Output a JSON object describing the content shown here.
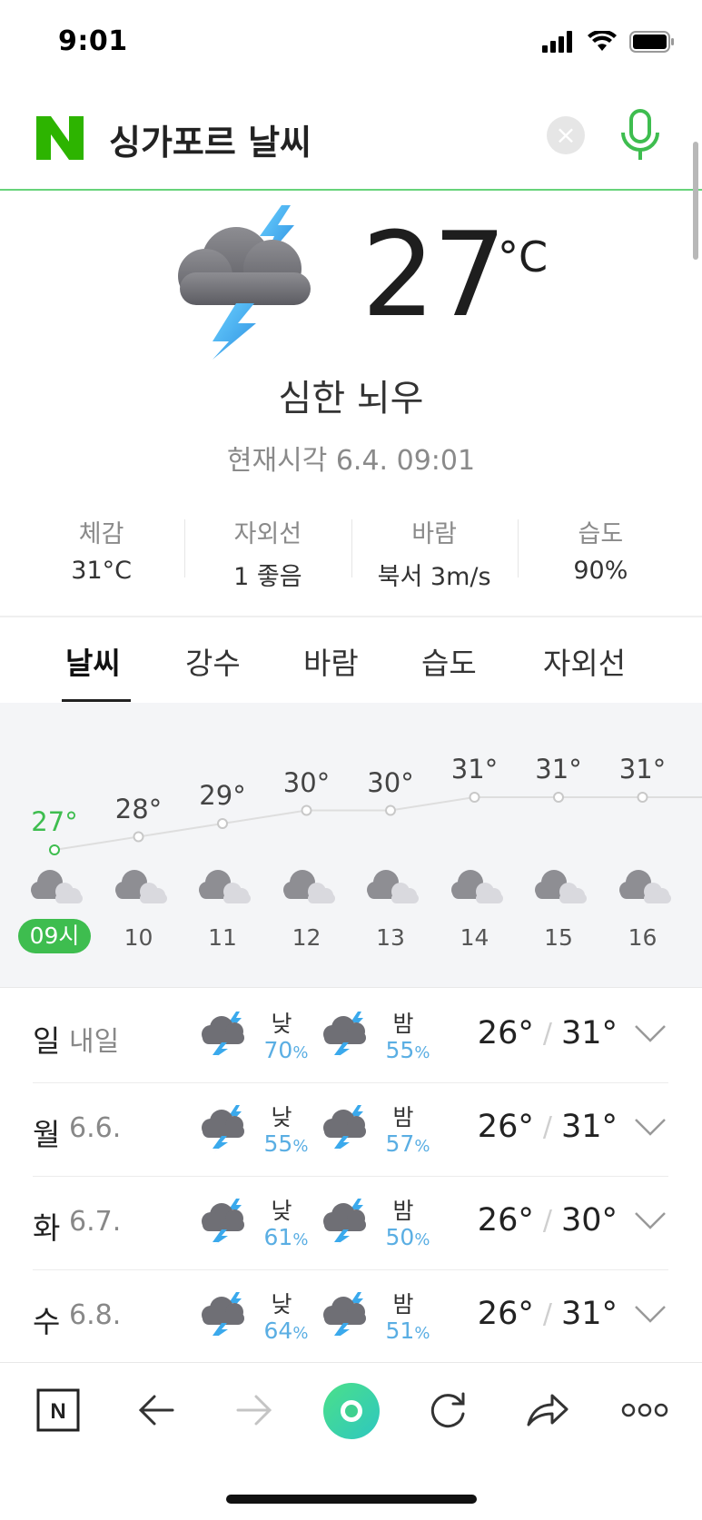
{
  "status_bar": {
    "time": "9:01",
    "icons": [
      "signal-icon",
      "wifi-icon",
      "battery-icon"
    ]
  },
  "search": {
    "query": "싱가포르 날씨",
    "logo": "N",
    "clear_icon": "close-icon",
    "mic_icon": "microphone-icon"
  },
  "current": {
    "icon": "thunderstorm-icon",
    "temperature": "27",
    "unit": "°C",
    "condition": "심한 뇌우",
    "time_label": "현재시각 6.4. 09:01"
  },
  "stats": [
    {
      "label": "체감",
      "value": "31°C"
    },
    {
      "label": "자외선",
      "value": "1 좋음"
    },
    {
      "label": "바람",
      "value": "북서 3m/s"
    },
    {
      "label": "습도",
      "value": "90%"
    }
  ],
  "tabs": [
    {
      "label": "날씨",
      "active": true
    },
    {
      "label": "강수",
      "active": false
    },
    {
      "label": "바람",
      "active": false
    },
    {
      "label": "습도",
      "active": false
    },
    {
      "label": "자외선",
      "active": false
    }
  ],
  "hourly": [
    {
      "hour": "09시",
      "temp": "27°",
      "value": 27,
      "now": true,
      "icon": "cloudy-icon"
    },
    {
      "hour": "10",
      "temp": "28°",
      "value": 28,
      "now": false,
      "icon": "cloudy-icon"
    },
    {
      "hour": "11",
      "temp": "29°",
      "value": 29,
      "now": false,
      "icon": "cloudy-icon"
    },
    {
      "hour": "12",
      "temp": "30°",
      "value": 30,
      "now": false,
      "icon": "cloudy-icon"
    },
    {
      "hour": "13",
      "temp": "30°",
      "value": 30,
      "now": false,
      "icon": "cloudy-icon"
    },
    {
      "hour": "14",
      "temp": "31°",
      "value": 31,
      "now": false,
      "icon": "cloudy-icon"
    },
    {
      "hour": "15",
      "temp": "31°",
      "value": 31,
      "now": false,
      "icon": "cloudy-icon"
    },
    {
      "hour": "16",
      "temp": "31°",
      "value": 31,
      "now": false,
      "icon": "cloudy-icon"
    }
  ],
  "daily": [
    {
      "day": "일",
      "date": "내일",
      "am_label": "낮",
      "am_pct": "70",
      "pm_label": "밤",
      "pm_pct": "55",
      "low": "26°",
      "high": "31°"
    },
    {
      "day": "월",
      "date": "6.6.",
      "am_label": "낮",
      "am_pct": "55",
      "pm_label": "밤",
      "pm_pct": "57",
      "low": "26°",
      "high": "31°"
    },
    {
      "day": "화",
      "date": "6.7.",
      "am_label": "낮",
      "am_pct": "61",
      "pm_label": "밤",
      "pm_pct": "50",
      "low": "26°",
      "high": "30°"
    },
    {
      "day": "수",
      "date": "6.8.",
      "am_label": "낮",
      "am_pct": "64",
      "pm_label": "밤",
      "pm_pct": "51",
      "low": "26°",
      "high": "31°"
    }
  ],
  "pct_unit": "%",
  "temp_separator": "/",
  "toolbar": {
    "buttons": [
      "naver-home-icon",
      "back-arrow-icon",
      "forward-arrow-icon",
      "green-dot-icon",
      "refresh-icon",
      "share-icon",
      "more-icon"
    ],
    "naver_label": "N"
  },
  "colors": {
    "accent_green": "#3ebd4f",
    "header_line": "#67d37a",
    "rain_blue": "#5aaee3",
    "lightning_blue": "#3aa9ec"
  }
}
